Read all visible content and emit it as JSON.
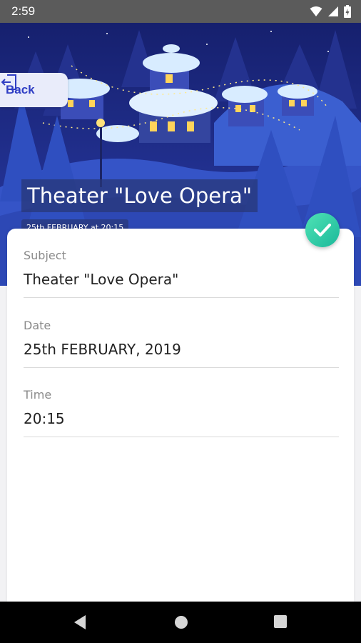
{
  "status_bar": {
    "time": "2:59"
  },
  "header": {
    "back_label": "Back",
    "title": "Theater \"Love Opera\"",
    "subtitle": "25th FEBRUARY at 20:15"
  },
  "fields": [
    {
      "label": "Subject",
      "value": "Theater \"Love Opera\""
    },
    {
      "label": "Date",
      "value": "25th FEBRUARY, 2019"
    },
    {
      "label": "Time",
      "value": "20:15"
    }
  ],
  "colors": {
    "accent": "#2f3ec4",
    "check": "#25c9a3",
    "hero_bg": "#1e2a84"
  },
  "icons": [
    "wifi-icon",
    "signal-icon",
    "battery-icon",
    "logout-door-icon",
    "checkmark-icon",
    "nav-back-icon",
    "nav-home-icon",
    "nav-recents-icon"
  ]
}
